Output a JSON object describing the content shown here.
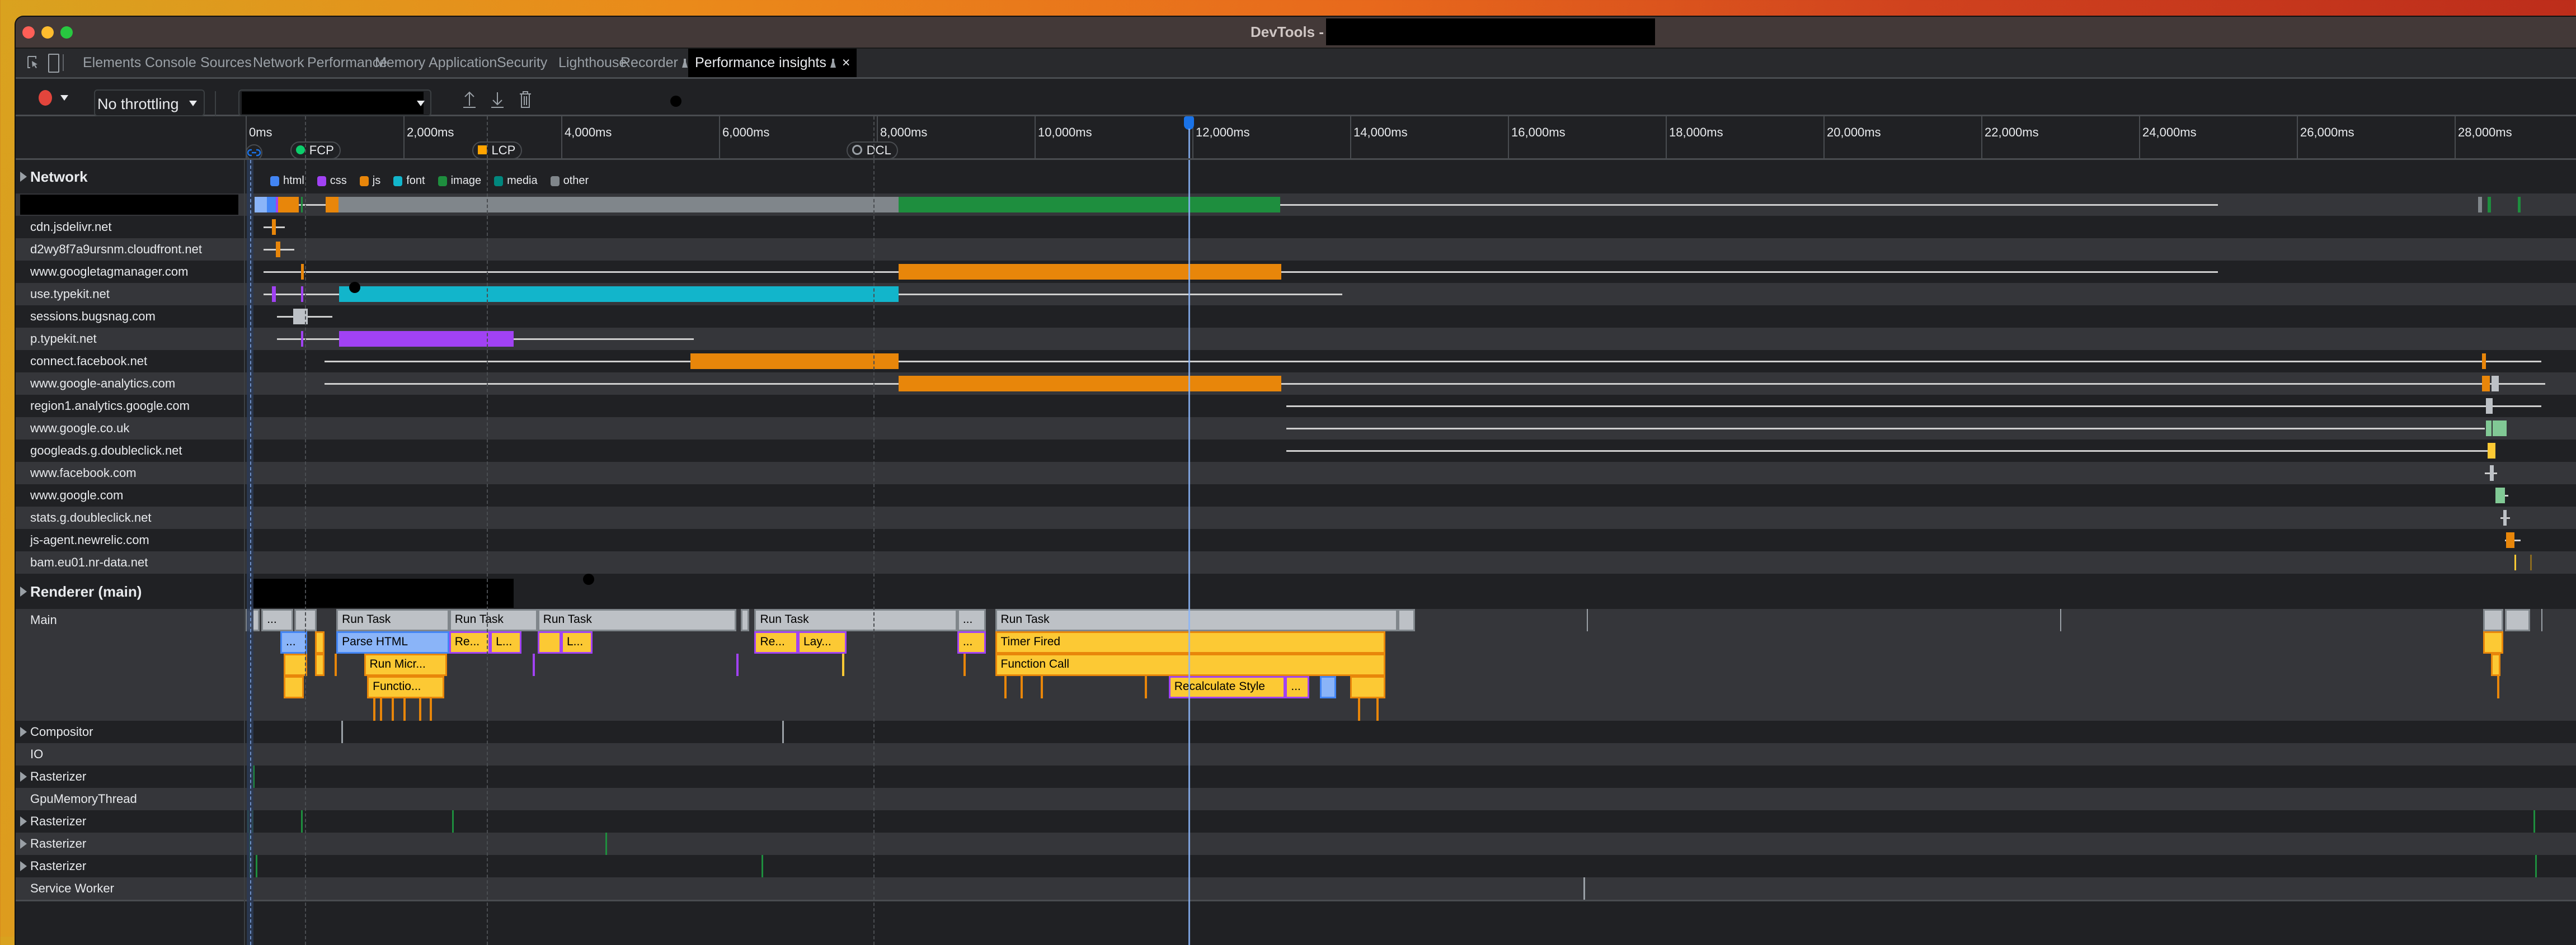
{
  "window": {
    "title_prefix": "DevTools -",
    "title_redacted": true
  },
  "tabs": [
    {
      "label": "Elements",
      "active": false
    },
    {
      "label": "Console",
      "active": false
    },
    {
      "label": "Sources",
      "active": false
    },
    {
      "label": "Network",
      "active": false
    },
    {
      "label": "Performance",
      "active": false
    },
    {
      "label": "Memory",
      "active": false
    },
    {
      "label": "Application",
      "active": false
    },
    {
      "label": "Security",
      "active": false
    },
    {
      "label": "Lighthouse",
      "active": false
    },
    {
      "label": "Recorder",
      "active": false,
      "experimental": true
    },
    {
      "label": "Performance insights",
      "active": true,
      "experimental": true,
      "closable": true
    }
  ],
  "toolbar": {
    "record_icon": "record-icon",
    "throttling": "No throttling",
    "recording_select_redacted": true,
    "upload_icon": "upload-icon",
    "download_icon": "download-icon",
    "delete_icon": "trash-icon"
  },
  "ruler": {
    "ticks_ms": [
      0,
      2000,
      4000,
      6000,
      8000,
      10000,
      12000,
      14000,
      16000,
      18000,
      20000,
      22000,
      24000,
      26000,
      28000
    ],
    "tick_labels": [
      "0ms",
      "2,000ms",
      "4,000ms",
      "6,000ms",
      "8,000ms",
      "10,000ms",
      "12,000ms",
      "14,000ms",
      "16,000ms",
      "18,000ms",
      "20,000ms",
      "22,000ms",
      "24,000ms",
      "26,000ms",
      "28,000ms"
    ],
    "playhead_ms": 11950,
    "markers": [
      {
        "label": "FCP",
        "ms": 750,
        "color": "#0cce6b",
        "shape": "circle"
      },
      {
        "label": "LCP",
        "ms": 3060,
        "color": "#ffa400",
        "shape": "square"
      },
      {
        "label": "DCL",
        "ms": 7800,
        "color": "#9aa0a6",
        "shape": "ring"
      }
    ],
    "nav_marker_icon": "navigation-link-icon",
    "nav_ms": 60
  },
  "gridlines_ms": [
    750,
    3060,
    7960
  ],
  "network": {
    "title": "Network",
    "legend": [
      {
        "label": "html",
        "color": "#4285f4"
      },
      {
        "label": "css",
        "color": "#a142f4"
      },
      {
        "label": "js",
        "color": "#e8860a"
      },
      {
        "label": "font",
        "color": "#12b5cb"
      },
      {
        "label": "image",
        "color": "#1e8e3e"
      },
      {
        "label": "media",
        "color": "#01877e"
      },
      {
        "label": "other",
        "color": "#80868b"
      }
    ],
    "rows": [
      {
        "domain": "",
        "redacted": true,
        "lines": [
          [
            230,
            25000
          ]
        ],
        "bars": [
          [
            113,
            270,
            "#8ab4f8"
          ],
          [
            270,
            383,
            "#4285f4"
          ],
          [
            383,
            410,
            "#a142f4"
          ],
          [
            410,
            674,
            "#e8860a"
          ],
          [
            700,
            720,
            "#1e8e3e"
          ],
          [
            1014,
            1177,
            "#e8860a"
          ],
          [
            1177,
            8277,
            "#80868b"
          ],
          [
            8277,
            13113,
            "#1e8e3e"
          ],
          [
            28300,
            28350,
            "#80868b"
          ],
          [
            28420,
            28460,
            "#1e8e3e"
          ],
          [
            28800,
            28840,
            "#1e8e3e"
          ]
        ]
      },
      {
        "domain": "cdn.jsdelivr.net",
        "lines": [
          [
            230,
            500
          ]
        ],
        "bars": [
          [
            330,
            380,
            "#e8860a"
          ]
        ]
      },
      {
        "domain": "d2wy8f7a9ursnm.cloudfront.net",
        "lines": [
          [
            230,
            620
          ]
        ],
        "bars": [
          [
            380,
            440,
            "#e8860a"
          ]
        ]
      },
      {
        "domain": "www.googletagmanager.com",
        "lines": [
          [
            230,
            25000
          ]
        ],
        "bars": [
          [
            700,
            735,
            "#e8860a"
          ],
          [
            8277,
            13127,
            "#e8860a"
          ]
        ]
      },
      {
        "domain": "use.typekit.net",
        "lines": [
          [
            230,
            13900
          ]
        ],
        "bars": [
          [
            330,
            380,
            "#a142f4"
          ],
          [
            700,
            730,
            "#a142f4"
          ],
          [
            1184,
            8277,
            "#12b5cb"
          ]
        ]
      },
      {
        "domain": "sessions.bugsnag.com",
        "lines": [
          [
            400,
            1100
          ]
        ],
        "bars": [
          [
            600,
            790,
            "#bdc1c6"
          ]
        ]
      },
      {
        "domain": "p.typekit.net",
        "lines": [
          [
            400,
            5680
          ]
        ],
        "bars": [
          [
            700,
            730,
            "#a142f4"
          ],
          [
            1184,
            3400,
            "#a142f4"
          ]
        ]
      },
      {
        "domain": "connect.facebook.net",
        "lines": [
          [
            1000,
            29100
          ]
        ],
        "bars": [
          [
            5640,
            8277,
            "#e8860a"
          ],
          [
            28350,
            28400,
            "#e8860a"
          ]
        ]
      },
      {
        "domain": "www.google-analytics.com",
        "lines": [
          [
            1000,
            29150
          ]
        ],
        "bars": [
          [
            8277,
            13127,
            "#e8860a"
          ],
          [
            28350,
            28450,
            "#e8860a"
          ],
          [
            28470,
            28560,
            "#bdc1c6"
          ]
        ]
      },
      {
        "domain": "region1.analytics.google.com",
        "lines": [
          [
            13190,
            29100
          ]
        ],
        "bars": [
          [
            28400,
            28480,
            "#bdc1c6"
          ]
        ]
      },
      {
        "domain": "www.google.co.uk",
        "lines": [
          [
            13190,
            28380
          ]
        ],
        "bars": [
          [
            28400,
            28470,
            "#81c995"
          ],
          [
            28480,
            28660,
            "#81c995"
          ]
        ]
      },
      {
        "domain": "googleads.g.doubleclick.net",
        "lines": [
          [
            13190,
            28500
          ]
        ],
        "bars": [
          [
            28420,
            28520,
            "#fcc934"
          ]
        ]
      },
      {
        "domain": "www.facebook.com",
        "lines": [
          [
            28380,
            28540
          ]
        ],
        "bars": [
          [
            28450,
            28500,
            "#bdc1c6"
          ]
        ]
      },
      {
        "domain": "www.google.com",
        "lines": [
          [
            28520,
            28680
          ]
        ],
        "bars": [
          [
            28520,
            28640,
            "#81c995"
          ]
        ]
      },
      {
        "domain": "stats.g.doubleclick.net",
        "lines": [
          [
            28580,
            28700
          ]
        ],
        "bars": [
          [
            28620,
            28660,
            "#bdc1c6"
          ]
        ]
      },
      {
        "domain": "js-agent.newrelic.com",
        "lines": [
          [
            28640,
            28840
          ]
        ],
        "bars": [
          [
            28650,
            28760,
            "#e8860a"
          ]
        ]
      },
      {
        "domain": "bam.eu01.nr-data.net",
        "lines": [],
        "bars": [
          [
            28760,
            28780,
            "#fcc934"
          ],
          [
            28960,
            28980,
            "#8a6a20"
          ]
        ]
      }
    ]
  },
  "renderer": {
    "title": "Renderer (main)",
    "title_redacted_overlay": true,
    "main_label": "Main",
    "flame": [
      {
        "level": 0,
        "start": 0,
        "end": 180,
        "kind": "task",
        "label": ""
      },
      {
        "level": 0,
        "start": 200,
        "end": 600,
        "kind": "task",
        "label": "..."
      },
      {
        "level": 0,
        "start": 620,
        "end": 900,
        "kind": "task",
        "label": ""
      },
      {
        "level": 0,
        "start": 1150,
        "end": 2580,
        "kind": "task",
        "label": "Run Task"
      },
      {
        "level": 0,
        "start": 2580,
        "end": 3700,
        "kind": "task",
        "label": "Run Task"
      },
      {
        "level": 0,
        "start": 3700,
        "end": 6220,
        "kind": "task",
        "label": "Run Task"
      },
      {
        "level": 0,
        "start": 6280,
        "end": 6380,
        "kind": "task",
        "label": ""
      },
      {
        "level": 0,
        "start": 6450,
        "end": 9020,
        "kind": "task",
        "label": "Run Task"
      },
      {
        "level": 0,
        "start": 9020,
        "end": 9380,
        "kind": "task",
        "label": "..."
      },
      {
        "level": 0,
        "start": 9500,
        "end": 14600,
        "kind": "task",
        "label": "Run Task"
      },
      {
        "level": 0,
        "start": 14600,
        "end": 14820,
        "kind": "task",
        "label": ""
      },
      {
        "level": 1,
        "start": 440,
        "end": 780,
        "kind": "parse",
        "label": "..."
      },
      {
        "level": 1,
        "start": 880,
        "end": 1000,
        "kind": "script",
        "label": ""
      },
      {
        "level": 1,
        "start": 1150,
        "end": 2580,
        "kind": "parse",
        "label": "Parse HTML"
      },
      {
        "level": 1,
        "start": 2580,
        "end": 3100,
        "kind": "render",
        "label": "Re..."
      },
      {
        "level": 1,
        "start": 3100,
        "end": 3500,
        "kind": "render",
        "label": "L..."
      },
      {
        "level": 1,
        "start": 3700,
        "end": 4000,
        "kind": "render",
        "label": ""
      },
      {
        "level": 1,
        "start": 4000,
        "end": 4400,
        "kind": "render",
        "label": "L..."
      },
      {
        "level": 1,
        "start": 6450,
        "end": 7000,
        "kind": "render",
        "label": "Re..."
      },
      {
        "level": 1,
        "start": 7000,
        "end": 7620,
        "kind": "render",
        "label": "Lay..."
      },
      {
        "level": 1,
        "start": 9020,
        "end": 9380,
        "kind": "render",
        "label": "..."
      },
      {
        "level": 1,
        "start": 9500,
        "end": 14450,
        "kind": "script",
        "label": "Timer Fired"
      },
      {
        "level": 2,
        "start": 480,
        "end": 780,
        "kind": "script",
        "label": ""
      },
      {
        "level": 2,
        "start": 880,
        "end": 1000,
        "kind": "script",
        "label": ""
      },
      {
        "level": 2,
        "start": 1500,
        "end": 2550,
        "kind": "script",
        "label": "Run Micr..."
      },
      {
        "level": 2,
        "start": 9500,
        "end": 14450,
        "kind": "script",
        "label": "Function Call"
      },
      {
        "level": 3,
        "start": 480,
        "end": 740,
        "kind": "script",
        "label": ""
      },
      {
        "level": 3,
        "start": 1540,
        "end": 2520,
        "kind": "script",
        "label": "Functio..."
      },
      {
        "level": 3,
        "start": 11700,
        "end": 13180,
        "kind": "render",
        "label": "Recalculate Style"
      },
      {
        "level": 3,
        "start": 13180,
        "end": 13480,
        "kind": "render",
        "label": "..."
      },
      {
        "level": 3,
        "start": 13620,
        "end": 13820,
        "kind": "parse",
        "label": ""
      },
      {
        "level": 3,
        "start": 14000,
        "end": 14450,
        "kind": "script",
        "label": ""
      },
      {
        "level": 0,
        "start": 28360,
        "end": 28620,
        "kind": "task",
        "label": ""
      },
      {
        "level": 0,
        "start": 28640,
        "end": 28960,
        "kind": "task",
        "label": ""
      },
      {
        "level": 1,
        "start": 28360,
        "end": 28620,
        "kind": "script",
        "label": ""
      },
      {
        "level": 2,
        "start": 28460,
        "end": 28580,
        "kind": "script",
        "label": ""
      }
    ],
    "thin_events": [
      {
        "level": 2,
        "ms": 1130,
        "color": "#e8860a"
      },
      {
        "level": 4,
        "ms": 1620,
        "color": "#e8860a"
      },
      {
        "level": 4,
        "ms": 1700,
        "color": "#e8860a"
      },
      {
        "level": 4,
        "ms": 1850,
        "color": "#e8860a"
      },
      {
        "level": 4,
        "ms": 2000,
        "color": "#e8860a"
      },
      {
        "level": 4,
        "ms": 2200,
        "color": "#e8860a"
      },
      {
        "level": 4,
        "ms": 2330,
        "color": "#e8860a"
      },
      {
        "level": 2,
        "ms": 3640,
        "color": "#a142f4"
      },
      {
        "level": 2,
        "ms": 6220,
        "color": "#a142f4"
      },
      {
        "level": 2,
        "ms": 7560,
        "color": "#fcc934"
      },
      {
        "level": 2,
        "ms": 9100,
        "color": "#e8860a"
      },
      {
        "level": 3,
        "ms": 9620,
        "color": "#e8860a"
      },
      {
        "level": 3,
        "ms": 9820,
        "color": "#e8860a"
      },
      {
        "level": 3,
        "ms": 10080,
        "color": "#e8860a"
      },
      {
        "level": 3,
        "ms": 11400,
        "color": "#e8860a"
      },
      {
        "level": 4,
        "ms": 14100,
        "color": "#e8860a"
      },
      {
        "level": 4,
        "ms": 14330,
        "color": "#e8860a"
      },
      {
        "level": 3,
        "ms": 28540,
        "color": "#e8860a"
      }
    ],
    "idle_ticks_ms": [
      14900,
      20000,
      26100,
      20000
    ],
    "idle_task_ticks_ms": [
      17000,
      23000,
      29100
    ]
  },
  "threads": [
    {
      "label": "Compositor",
      "expandable": true,
      "events": [
        [
          1210,
          "#9aa0a6"
        ],
        [
          6800,
          "#9aa0a6"
        ]
      ]
    },
    {
      "label": "IO",
      "expandable": false,
      "events": []
    },
    {
      "label": "Rasterizer",
      "expandable": true,
      "events": [
        [
          90,
          "#1e8e3e"
        ]
      ]
    },
    {
      "label": "GpuMemoryThread",
      "expandable": false,
      "events": []
    },
    {
      "label": "Rasterizer",
      "expandable": true,
      "events": [
        [
          20,
          "#1e8e3e"
        ],
        [
          80,
          "#1e8e3e"
        ],
        [
          700,
          "#1e8e3e"
        ],
        [
          2620,
          "#1e8e3e"
        ],
        [
          29000,
          "#1e8e3e"
        ]
      ]
    },
    {
      "label": "Rasterizer",
      "expandable": true,
      "events": [
        [
          40,
          "#1e8e3e"
        ],
        [
          4560,
          "#1e8e3e"
        ]
      ]
    },
    {
      "label": "Rasterizer",
      "expandable": true,
      "events": [
        [
          40,
          "#1e8e3e"
        ],
        [
          130,
          "#1e8e3e"
        ],
        [
          6540,
          "#1e8e3e"
        ],
        [
          29020,
          "#1e8e3e"
        ]
      ]
    },
    {
      "label": "Service Worker",
      "expandable": false,
      "events": [
        [
          16960,
          "#9aa0a6"
        ]
      ]
    }
  ],
  "sidebar_toggle_icon": "chevron-right-icon"
}
